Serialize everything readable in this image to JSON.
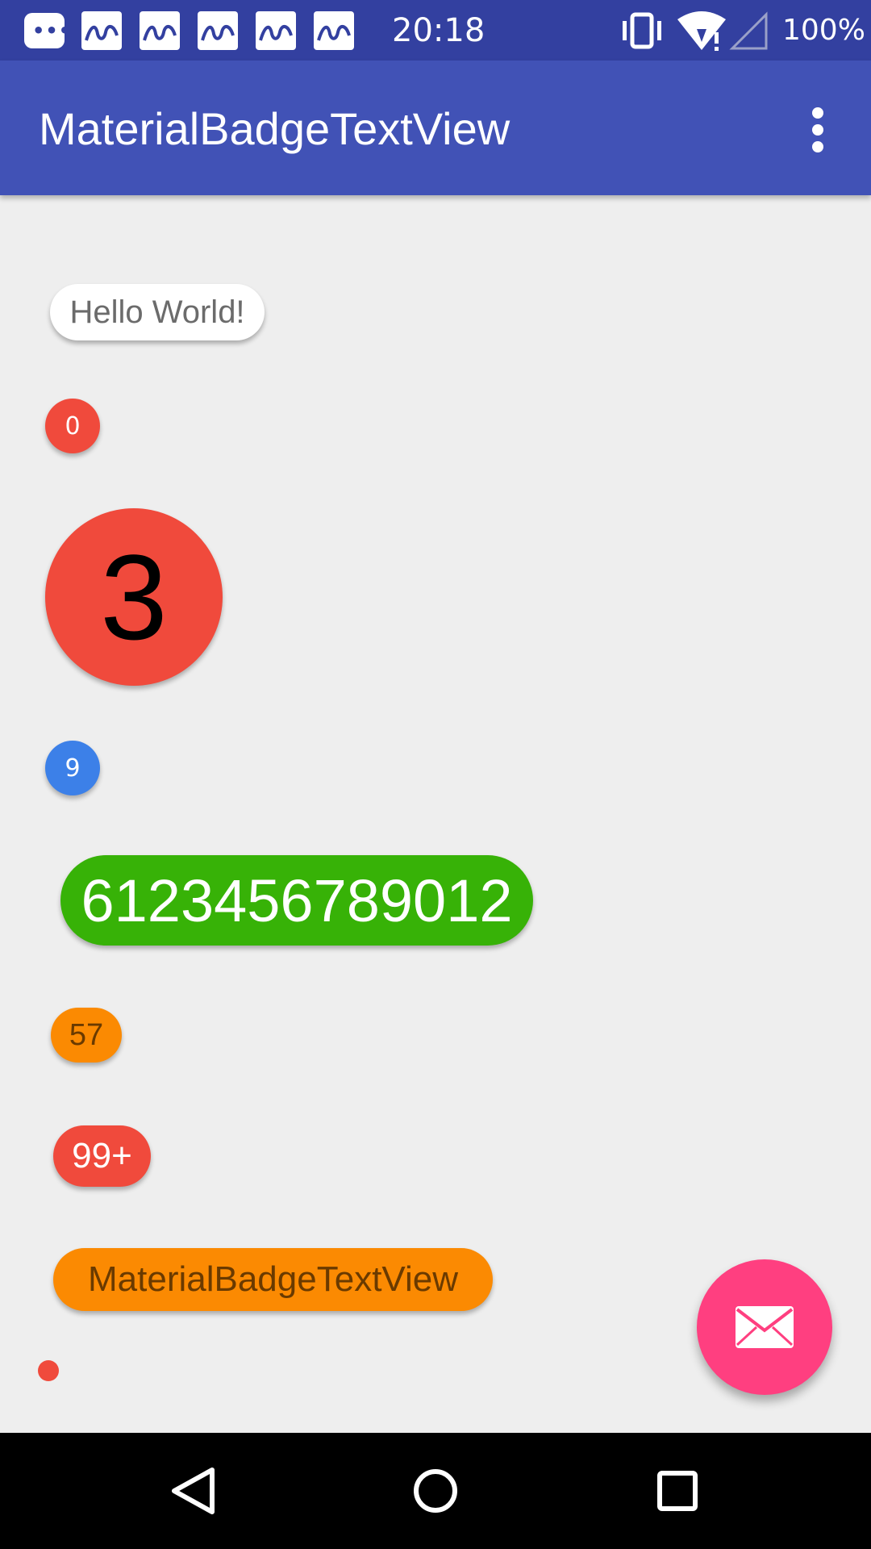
{
  "status_bar": {
    "time": "20:18",
    "battery": "100%",
    "icons": [
      "message-notification-icon",
      "app-notification-icon",
      "app-notification-icon",
      "app-notification-icon",
      "app-notification-icon",
      "app-notification-icon",
      "vibrate-icon",
      "wifi-icon",
      "cell-signal-icon"
    ]
  },
  "app_bar": {
    "title": "MaterialBadgeTextView",
    "menu_icon": "overflow-menu-icon"
  },
  "badges": {
    "hello": "Hello World!",
    "zero": "0",
    "three": "3",
    "nine": "9",
    "long_number": "6123456789012",
    "fifty_seven": "57",
    "ninety_nine_plus": "99+",
    "name": "MaterialBadgeTextView"
  },
  "colors": {
    "primary": "#4152b6",
    "primary_dark": "#3340a0",
    "red": "#f04a3c",
    "blue": "#3c80e8",
    "green": "#37b207",
    "orange": "#fb8a02",
    "accent": "#ff3f80"
  },
  "fab": {
    "icon": "mail-icon"
  },
  "nav_bar": {
    "back": "back-icon",
    "home": "home-icon",
    "recents": "recents-icon"
  }
}
